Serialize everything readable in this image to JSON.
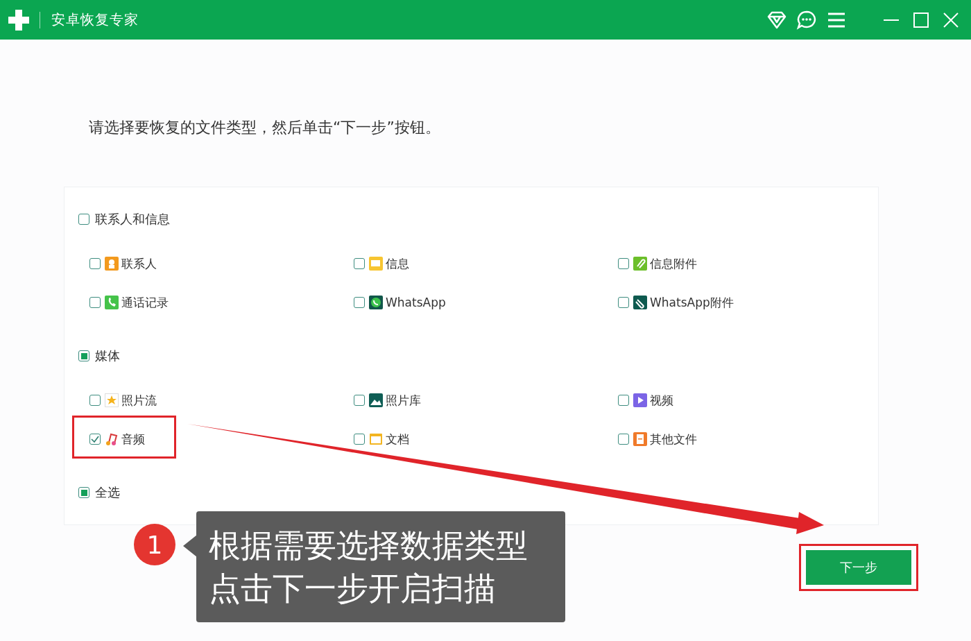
{
  "window": {
    "title": "安卓恢复专家"
  },
  "instruction": "请选择要恢复的文件类型，然后单击“下一步”按钮。",
  "groups": [
    {
      "label": "联系人和信息",
      "checked": false,
      "partial": false,
      "items": [
        {
          "label": "联系人",
          "checked": false
        },
        {
          "label": "信息",
          "checked": false
        },
        {
          "label": "信息附件",
          "checked": false
        },
        {
          "label": "通话记录",
          "checked": false
        },
        {
          "label": "WhatsApp",
          "checked": false
        },
        {
          "label": "WhatsApp附件",
          "checked": false
        }
      ]
    },
    {
      "label": "媒体",
      "checked": false,
      "partial": true,
      "items": [
        {
          "label": "照片流",
          "checked": false
        },
        {
          "label": "照片库",
          "checked": false
        },
        {
          "label": "视频",
          "checked": false
        },
        {
          "label": "音频",
          "checked": true
        },
        {
          "label": "文档",
          "checked": false
        },
        {
          "label": "其他文件",
          "checked": false
        }
      ]
    }
  ],
  "select_all": {
    "label": "全选",
    "checked": false,
    "partial": true
  },
  "next_button": "下一步",
  "annotation": {
    "number": "1",
    "lines": [
      "根据需要选择数据类型",
      "点击下一步开启扫描"
    ]
  }
}
